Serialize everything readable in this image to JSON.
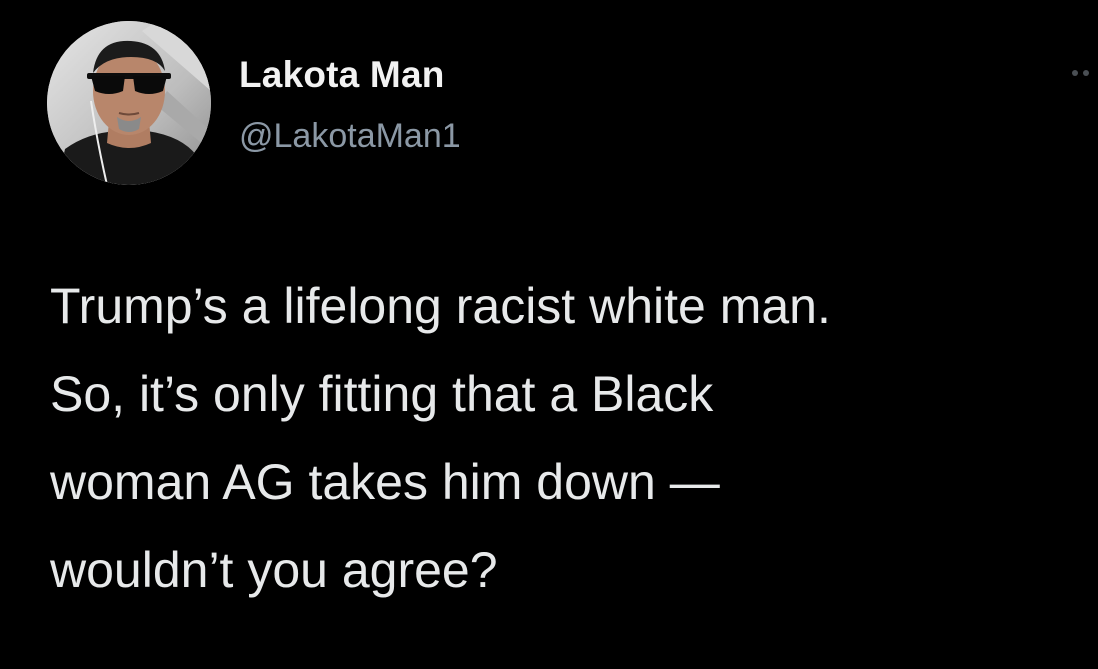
{
  "author": {
    "display_name": "Lakota Man",
    "handle": "@LakotaMan1",
    "avatar_icon": "profile-photo"
  },
  "menu": {
    "icon": "more-options-icon"
  },
  "tweet": {
    "lines": [
      "Trump’s a lifelong racist white man.",
      "So, it’s only fitting that a Black",
      "woman AG takes him down —",
      "wouldn’t you agree?"
    ]
  },
  "colors": {
    "background": "#000000",
    "text": "#e7e9ea",
    "secondary_text": "#8b98a5"
  }
}
